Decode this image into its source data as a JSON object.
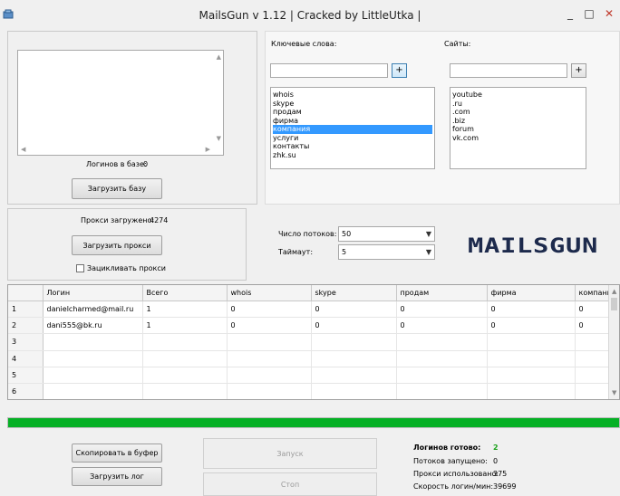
{
  "window": {
    "title": "MailsGun v 1.12 | Cracked by LittleUtka |",
    "minimize": "_",
    "maximize": "□",
    "close": "✕"
  },
  "database": {
    "count_label": "Логинов в базе:",
    "count_value": "0",
    "load_button": "Загрузить базу"
  },
  "keywords": {
    "label": "Ключевые слова:",
    "input_value": "",
    "add_button": "+",
    "items": [
      "whois",
      "skype",
      "продам",
      "фирма",
      "компания",
      "услуги",
      "контакты",
      "zhk.su"
    ],
    "selected_index": 4
  },
  "sites": {
    "label": "Сайты:",
    "input_value": "",
    "add_button": "+",
    "items": [
      "youtube",
      ".ru",
      ".com",
      ".biz",
      "forum",
      "vk.com"
    ]
  },
  "proxy": {
    "loaded_label": "Прокси загружено:",
    "loaded_value": "4274",
    "load_button": "Загрузить прокси",
    "loop_label": "Зацикливать прокси",
    "loop_checked": false
  },
  "settings": {
    "threads_label": "Число потоков:",
    "threads_value": "50",
    "timeout_label": "Таймаут:",
    "timeout_value": "5"
  },
  "logo_text": "MAILSGUN",
  "table": {
    "columns": [
      "",
      "Логин",
      "Всего",
      "whois",
      "skype",
      "продам",
      "фирма",
      "компания"
    ],
    "rows": [
      [
        "1",
        "danielcharmed@mail.ru",
        "1",
        "0",
        "0",
        "0",
        "0",
        "0"
      ],
      [
        "2",
        "dani555@bk.ru",
        "1",
        "0",
        "0",
        "0",
        "0",
        "0"
      ],
      [
        "3",
        "",
        "",
        "",
        "",
        "",
        "",
        ""
      ],
      [
        "4",
        "",
        "",
        "",
        "",
        "",
        "",
        ""
      ],
      [
        "5",
        "",
        "",
        "",
        "",
        "",
        "",
        ""
      ],
      [
        "6",
        "",
        "",
        "",
        "",
        "",
        "",
        ""
      ]
    ]
  },
  "progress": {
    "fraction": 1.0,
    "color": "#06b025"
  },
  "actions": {
    "copy_button": "Скопировать в буфер",
    "load_log_button": "Загрузить лог",
    "start_button": "Запуск",
    "stop_button": "Стоп"
  },
  "stats": {
    "ready_label": "Логинов готово:",
    "ready_value": "2",
    "threads_label": "Потоков запущено:",
    "threads_value": "0",
    "proxy_label": "Прокси использовано:",
    "proxy_value": "375",
    "speed_label": "Скорость логин/мин:",
    "speed_value": "39699"
  }
}
